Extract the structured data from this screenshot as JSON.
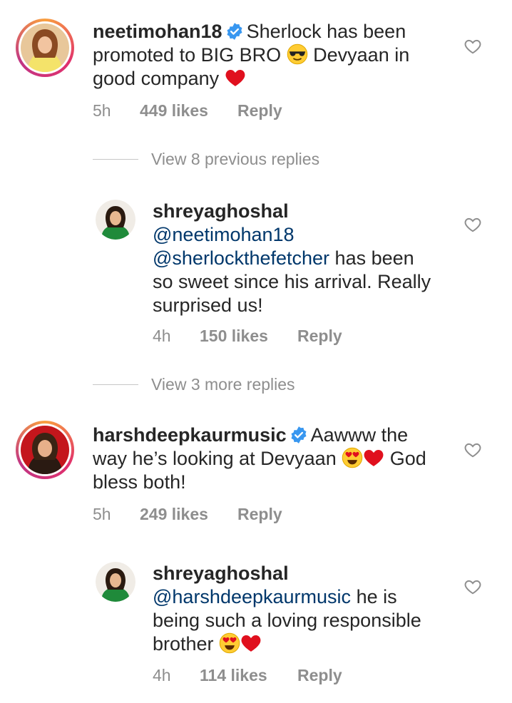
{
  "comments": [
    {
      "username": "neetimohan18",
      "verified": true,
      "text_parts": [
        "Sherlock has been",
        "promoted to BIG BRO",
        "Devyaan in",
        "good company"
      ],
      "time": "5h",
      "likes": "449 likes",
      "reply": "Reply"
    },
    {
      "username": "shreyaghoshal",
      "mention1": "@neetimohan18",
      "mention2": "@sherlockthefetcher",
      "text_after": "has been",
      "line3": "so sweet since his arrival. Really",
      "line4": "surprised us!",
      "time": "4h",
      "likes": "150 likes",
      "reply": "Reply"
    },
    {
      "username": "harshdeepkaurmusic",
      "verified": true,
      "text_parts": [
        "Aawww the",
        "way he’s looking at Devyaan",
        "God",
        "bless both!"
      ],
      "time": "5h",
      "likes": "249 likes",
      "reply": "Reply"
    },
    {
      "username": "shreyaghoshal",
      "mention1": "@harshdeepkaurmusic",
      "text_after": "he is",
      "line2": "being such a loving responsible",
      "line3": "brother",
      "time": "4h",
      "likes": "114 likes",
      "reply": "Reply"
    }
  ],
  "view_previous": "View 8 previous replies",
  "view_more": "View 3 more replies",
  "icons": {
    "verified": "verified-badge-icon",
    "like": "heart-outline-icon",
    "emoji_sunglasses": "sunglasses-emoji",
    "emoji_heart": "red-heart-emoji",
    "emoji_hearteyes": "heart-eyes-emoji"
  },
  "colors": {
    "mention": "#00376b",
    "meta": "#8e8e8e",
    "verified": "#3897f0"
  }
}
